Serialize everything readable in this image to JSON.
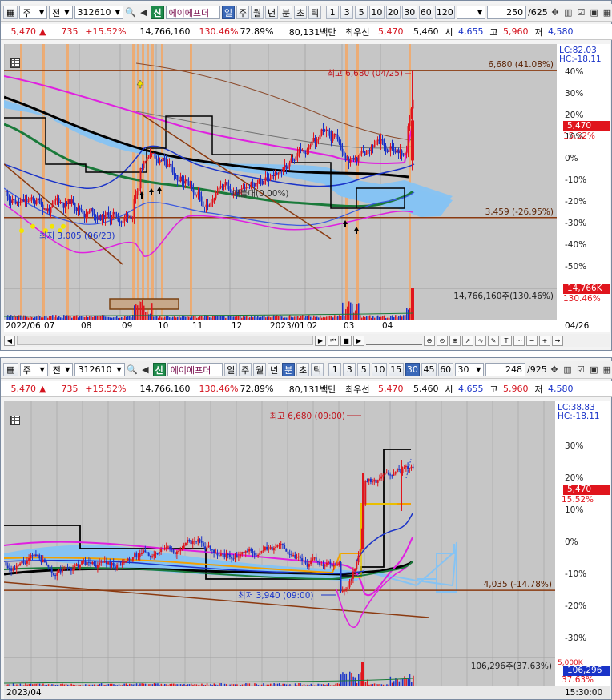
{
  "top": {
    "toolbar": {
      "market": "주",
      "prev_label": "전",
      "code": "312610",
      "new_tag": "신",
      "name": "에이에프더",
      "periods": [
        "일",
        "주",
        "월",
        "년",
        "분",
        "초",
        "틱"
      ],
      "selected_period": "일",
      "intervals": [
        "1",
        "3",
        "5",
        "10",
        "20",
        "30",
        "60",
        "120"
      ],
      "count": "250",
      "total": "/625"
    },
    "info": {
      "price": "5,470",
      "change_arrow": "▲",
      "change": "735",
      "change_pct": "+15.52%",
      "volume": "14,766,160",
      "vol_pct": "130.46%",
      "turnover": "72.89%",
      "amount": "80,131백만",
      "best_label": "최우선",
      "ask": "5,470",
      "bid": "5,460",
      "open_label": "시",
      "open": "4,655",
      "high_label": "고",
      "high": "5,960",
      "low_label": "저",
      "low": "4,580"
    },
    "lc": "LC:82.03",
    "hc": "HC:-18.11",
    "y_ticks": [
      "40%",
      "30%",
      "20%",
      "10%",
      "0%",
      "-10%",
      "-20%",
      "-30%",
      "-40%",
      "-50%"
    ],
    "price_tag": "5,470",
    "price_tag_pct": "15.52%",
    "high_line_label": "6,680 (41.08%)",
    "low_line_label": "3,459 (-26.95%)",
    "high_marker": "최고 6,680 (04/25)",
    "low_marker": "최저 3,005 (06/23)",
    "trend_label": "매물대(0.00%)",
    "volume_label": "14,766,160주(130.46%)",
    "volume_tag": "14,766K",
    "volume_tag_pct": "130.46%",
    "x_labels": [
      "2022/06",
      "07",
      "08",
      "09",
      "10",
      "11",
      "12",
      "2023/01",
      "02",
      "03",
      "04"
    ],
    "x_right": "04/26",
    "colors": {
      "up": "#e0151d",
      "down": "#1a33c8",
      "cloud": "#86c3f3",
      "orange_band": "#f2a766",
      "brown": "#8b3a10",
      "magenta": "#e020e0"
    }
  },
  "bottom": {
    "toolbar": {
      "market": "주",
      "prev_label": "전",
      "code": "312610",
      "new_tag": "신",
      "name": "에이에프더",
      "periods": [
        "일",
        "주",
        "월",
        "년",
        "분",
        "초",
        "틱"
      ],
      "selected_period": "분",
      "intervals": [
        "1",
        "3",
        "5",
        "10",
        "15",
        "30",
        "45",
        "60"
      ],
      "selected_interval": "30",
      "interval_value": "30",
      "count": "248",
      "total": "/925"
    },
    "info": {
      "price": "5,470",
      "change_arrow": "▲",
      "change": "735",
      "change_pct": "+15.52%",
      "volume": "14,766,160",
      "vol_pct": "130.46%",
      "turnover": "72.89%",
      "amount": "80,131백만",
      "best_label": "최우선",
      "ask": "5,470",
      "bid": "5,460",
      "open_label": "시",
      "open": "4,655",
      "high_label": "고",
      "high": "5,960",
      "low_label": "저",
      "low": "4,580"
    },
    "lc": "LC:38.83",
    "hc": "HC:-18.11",
    "y_ticks": [
      "30%",
      "20%",
      "10%",
      "0%",
      "-10%",
      "-20%",
      "-30%"
    ],
    "price_tag": "5,470",
    "price_tag_pct": "15.52%",
    "price_tag_pct2": "10%",
    "line_label": "4,035 (-14.78%)",
    "high_marker": "최고 6,680 (09:00)",
    "low_marker": "최저 3,940 (09:00)",
    "volume_label": "106,296주(37.63%)",
    "volume_tag": "106,296",
    "volume_tag_pct": "37.63%",
    "vol_axis": "5,000K",
    "x_left": "2023/04",
    "x_right": "15:30:00"
  }
}
